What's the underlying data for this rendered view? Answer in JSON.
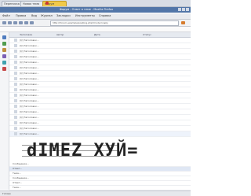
{
  "tabs": [
    "Переписка",
    "Новая тема",
    "Форум"
  ],
  "window": {
    "title": "Форум - Ответ в теме - Mozilla Firefox"
  },
  "menu": [
    "Файл",
    "Правка",
    "Вид",
    "Журнал",
    "Закладки",
    "Инструменты",
    "Справка"
  ],
  "url": "http://forum.example/posting.php?mode=reply",
  "columns": [
    "Заголовок",
    "Автор",
    "Дата",
    "Статус"
  ],
  "rows": [
    "[Q] Заголовок...",
    "[Q] Заголовок...",
    "[Q] Заголовок...",
    "[Q] Заголовок...",
    "[Q] Заголовок...",
    "[Q] Заголовок...",
    "[Q] Заголовок...",
    "[Q] Заголовок...",
    "[Q] Заголовок...",
    "[Q] Заголовок...",
    "[Q] Заголовок...",
    "[Q] Заголовок...",
    "[Q] Заголовок...",
    "[Q] Заголовок...",
    "[Q] Заголовок...",
    "[Q] Заголовок...",
    "[Q] Заголовок...",
    "[Q] Заголовок..."
  ],
  "captcha_text": "dIMEZ ХУЙ=",
  "list2": [
    "Сообщение...",
    "Ответ...",
    "Тема...",
    "Сообщение...",
    "Ответ...",
    "Тема..."
  ],
  "status": "Готово"
}
